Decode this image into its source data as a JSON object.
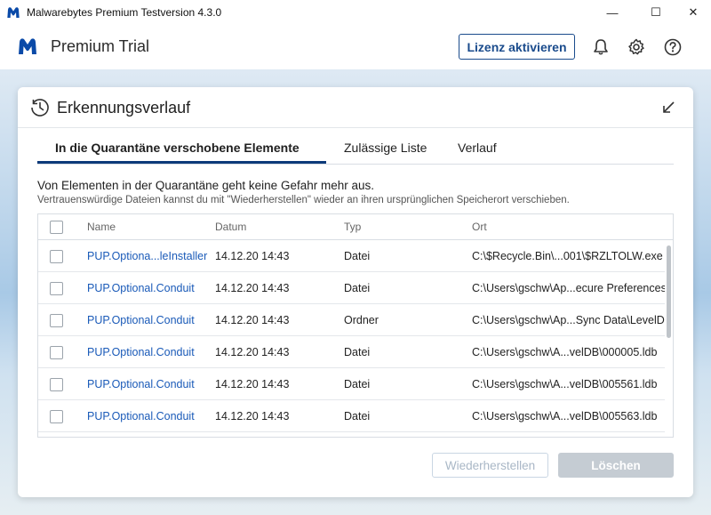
{
  "window": {
    "title": "Malwarebytes Premium Testversion  4.3.0",
    "minimize_glyph": "—",
    "maximize_glyph": "☐",
    "close_glyph": "✕"
  },
  "header": {
    "product_name": "Premium Trial",
    "activate_label": "Lizenz aktivieren",
    "icons": [
      "bell-icon",
      "gear-icon",
      "help-icon"
    ]
  },
  "panel": {
    "title": "Erkennungsverlauf",
    "tabs": [
      {
        "label": "In die Quarantäne verschobene Elemente",
        "active": true
      },
      {
        "label": "Zulässige Liste",
        "active": false
      },
      {
        "label": "Verlauf",
        "active": false
      }
    ],
    "info_main": "Von Elementen in der Quarantäne geht keine Gefahr mehr aus.",
    "info_sub": "Vertrauenswürdige Dateien kannst du mit \"Wiederherstellen\" wieder an ihren ursprünglichen Speicherort verschieben.",
    "columns": [
      "Name",
      "Datum",
      "Typ",
      "Ort"
    ],
    "rows": [
      {
        "name": "PUP.Optiona...leInstaller",
        "date": "14.12.20 14:43",
        "type": "Datei",
        "location": "C:\\$Recycle.Bin\\...001\\$RZLTOLW.exe"
      },
      {
        "name": "PUP.Optional.Conduit",
        "date": "14.12.20 14:43",
        "type": "Datei",
        "location": "C:\\Users\\gschw\\Ap...ecure Preferences"
      },
      {
        "name": "PUP.Optional.Conduit",
        "date": "14.12.20 14:43",
        "type": "Ordner",
        "location": "C:\\Users\\gschw\\Ap...Sync Data\\LevelDB"
      },
      {
        "name": "PUP.Optional.Conduit",
        "date": "14.12.20 14:43",
        "type": "Datei",
        "location": "C:\\Users\\gschw\\A...velDB\\000005.ldb"
      },
      {
        "name": "PUP.Optional.Conduit",
        "date": "14.12.20 14:43",
        "type": "Datei",
        "location": "C:\\Users\\gschw\\A...velDB\\005561.ldb"
      },
      {
        "name": "PUP.Optional.Conduit",
        "date": "14.12.20 14:43",
        "type": "Datei",
        "location": "C:\\Users\\gschw\\A...velDB\\005563.ldb"
      }
    ],
    "restore_label": "Wiederherstellen",
    "delete_label": "Löschen"
  },
  "colors": {
    "accent": "#0d3a7a",
    "link": "#1a5ab8",
    "brand": "#1a4b8c"
  }
}
